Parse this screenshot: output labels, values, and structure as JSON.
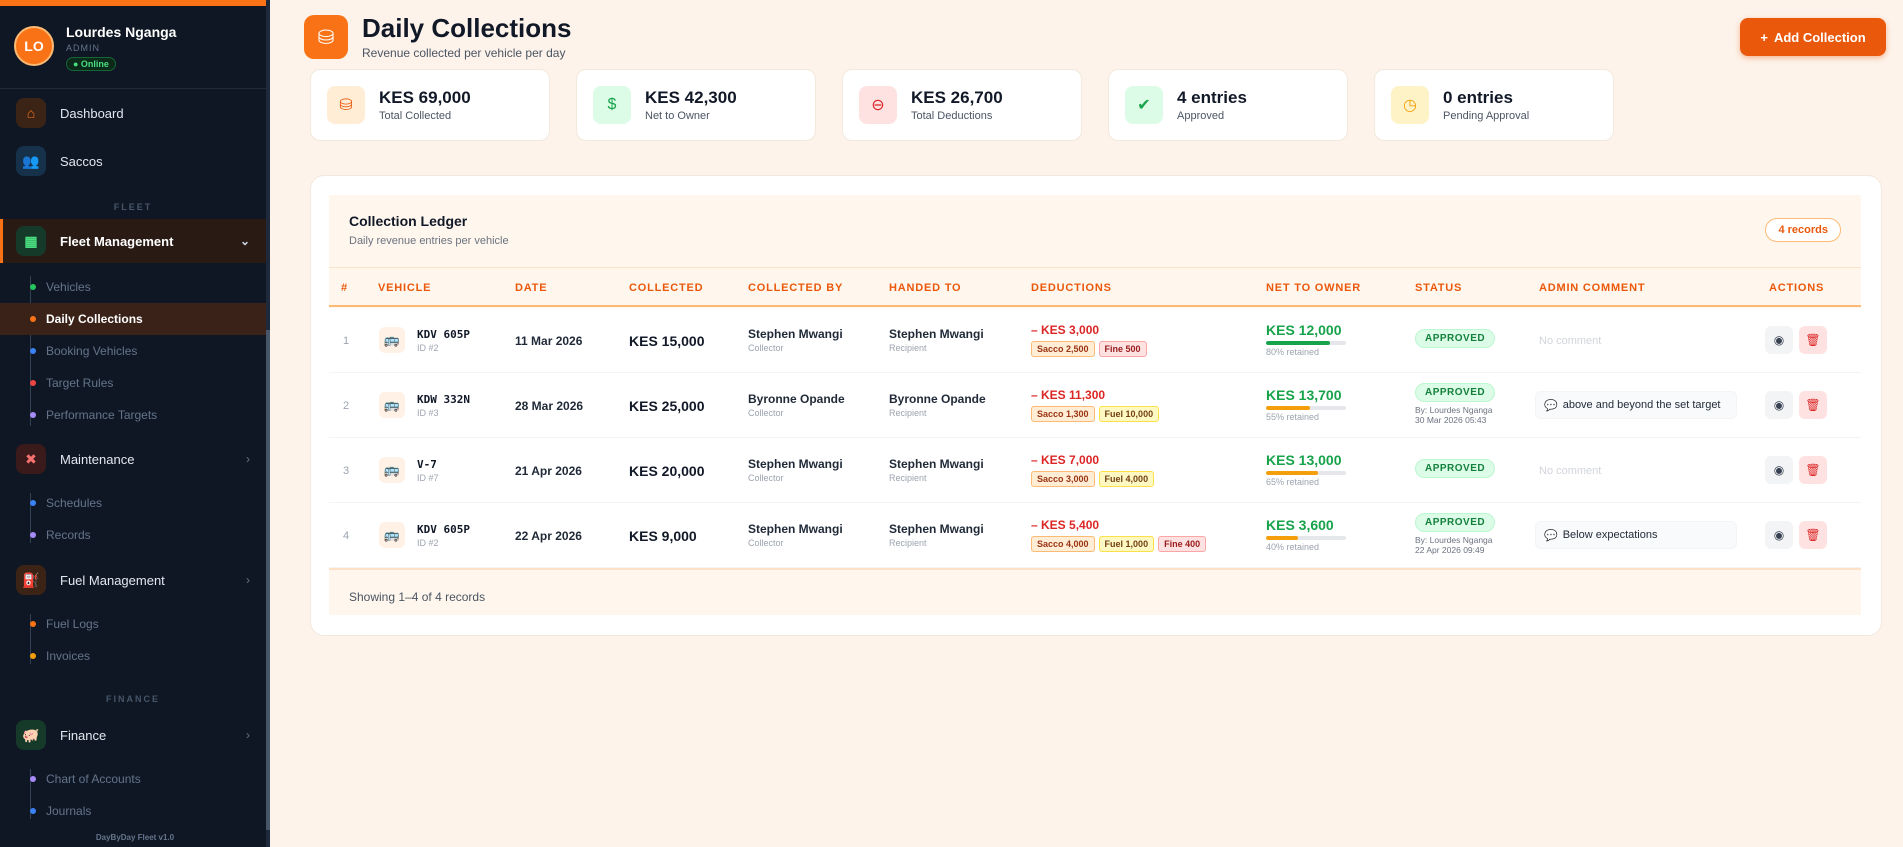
{
  "user": {
    "initials": "LO",
    "name": "Lourdes Nganga",
    "role": "ADMIN",
    "status": "● Online"
  },
  "sidebar": {
    "dashboard": "Dashboard",
    "saccos": "Saccos",
    "section_fleet": "FLEET",
    "fleet_management": "Fleet Management",
    "fleet_sub": [
      "Vehicles",
      "Daily Collections",
      "Booking Vehicles",
      "Target Rules",
      "Performance Targets"
    ],
    "maintenance": "Maintenance",
    "maint_sub": [
      "Schedules",
      "Records"
    ],
    "fuel_management": "Fuel Management",
    "fuel_sub": [
      "Fuel Logs",
      "Invoices"
    ],
    "section_finance": "FINANCE",
    "finance": "Finance",
    "finance_sub": [
      "Chart of Accounts",
      "Journals"
    ],
    "footer": "DayByDay Fleet v1.0"
  },
  "header": {
    "title": "Daily Collections",
    "subtitle": "Revenue collected per vehicle per day",
    "add_button": "Add Collection"
  },
  "stats": [
    {
      "value": "KES 69,000",
      "label": "Total Collected"
    },
    {
      "value": "KES 42,300",
      "label": "Net to Owner"
    },
    {
      "value": "KES 26,700",
      "label": "Total Deductions"
    },
    {
      "value": "4 entries",
      "label": "Approved"
    },
    {
      "value": "0 entries",
      "label": "Pending Approval"
    }
  ],
  "ledger": {
    "title": "Collection Ledger",
    "subtitle": "Daily revenue entries per vehicle",
    "badge": "4 records",
    "columns": [
      "#",
      "VEHICLE",
      "DATE",
      "COLLECTED",
      "COLLECTED BY",
      "HANDED TO",
      "DEDUCTIONS",
      "NET TO OWNER",
      "STATUS",
      "ADMIN COMMENT",
      "ACTIONS"
    ],
    "rows": [
      {
        "num": "1",
        "plate": "KDV 605P",
        "vid": "ID #2",
        "date": "11 Mar 2026",
        "collected": "KES 15,000",
        "collector": "Stephen Mwangi",
        "collector_role": "Collector",
        "recipient": "Stephen Mwangi",
        "recipient_role": "Recipient",
        "deduction": "– KES 3,000",
        "tags": [
          "Sacco 2,500",
          "Fine 500"
        ],
        "net": "KES 12,000",
        "retained_pct": 80,
        "retained": "80% retained",
        "status": "APPROVED",
        "by_line1": "",
        "by_line2": "",
        "comment": "No comment"
      },
      {
        "num": "2",
        "plate": "KDW 332N",
        "vid": "ID #3",
        "date": "28 Mar 2026",
        "collected": "KES 25,000",
        "collector": "Byronne Opande",
        "collector_role": "Collector",
        "recipient": "Byronne Opande",
        "recipient_role": "Recipient",
        "deduction": "– KES 11,300",
        "tags": [
          "Sacco 1,300",
          "Fuel 10,000"
        ],
        "net": "KES 13,700",
        "retained_pct": 55,
        "retained": "55% retained",
        "status": "APPROVED",
        "by_line1": "By: Lourdes Nganga",
        "by_line2": "30 Mar 2026 05:43",
        "comment": "above and beyond the set target"
      },
      {
        "num": "3",
        "plate": "V-7",
        "vid": "ID #7",
        "date": "21 Apr 2026",
        "collected": "KES 20,000",
        "collector": "Stephen Mwangi",
        "collector_role": "Collector",
        "recipient": "Stephen Mwangi",
        "recipient_role": "Recipient",
        "deduction": "– KES 7,000",
        "tags": [
          "Sacco 3,000",
          "Fuel 4,000"
        ],
        "net": "KES 13,000",
        "retained_pct": 65,
        "retained": "65% retained",
        "status": "APPROVED",
        "by_line1": "",
        "by_line2": "",
        "comment": "No comment"
      },
      {
        "num": "4",
        "plate": "KDV 605P",
        "vid": "ID #2",
        "date": "22 Apr 2026",
        "collected": "KES 9,000",
        "collector": "Stephen Mwangi",
        "collector_role": "Collector",
        "recipient": "Stephen Mwangi",
        "recipient_role": "Recipient",
        "deduction": "– KES 5,400",
        "tags": [
          "Sacco 4,000",
          "Fuel 1,000",
          "Fine 400"
        ],
        "net": "KES 3,600",
        "retained_pct": 40,
        "retained": "40% retained",
        "status": "APPROVED",
        "by_line1": "By: Lourdes Nganga",
        "by_line2": "22 Apr 2026 09:49",
        "comment": "Below expectations"
      }
    ],
    "footer": "Showing 1–4 of 4 records"
  },
  "colors": {
    "accent": "#f97316",
    "green": "#16a34a",
    "red": "#dc2626",
    "sidebar": "#0f1724",
    "bar_green": "#16a34a",
    "bar_amber": "#f59e0b"
  }
}
